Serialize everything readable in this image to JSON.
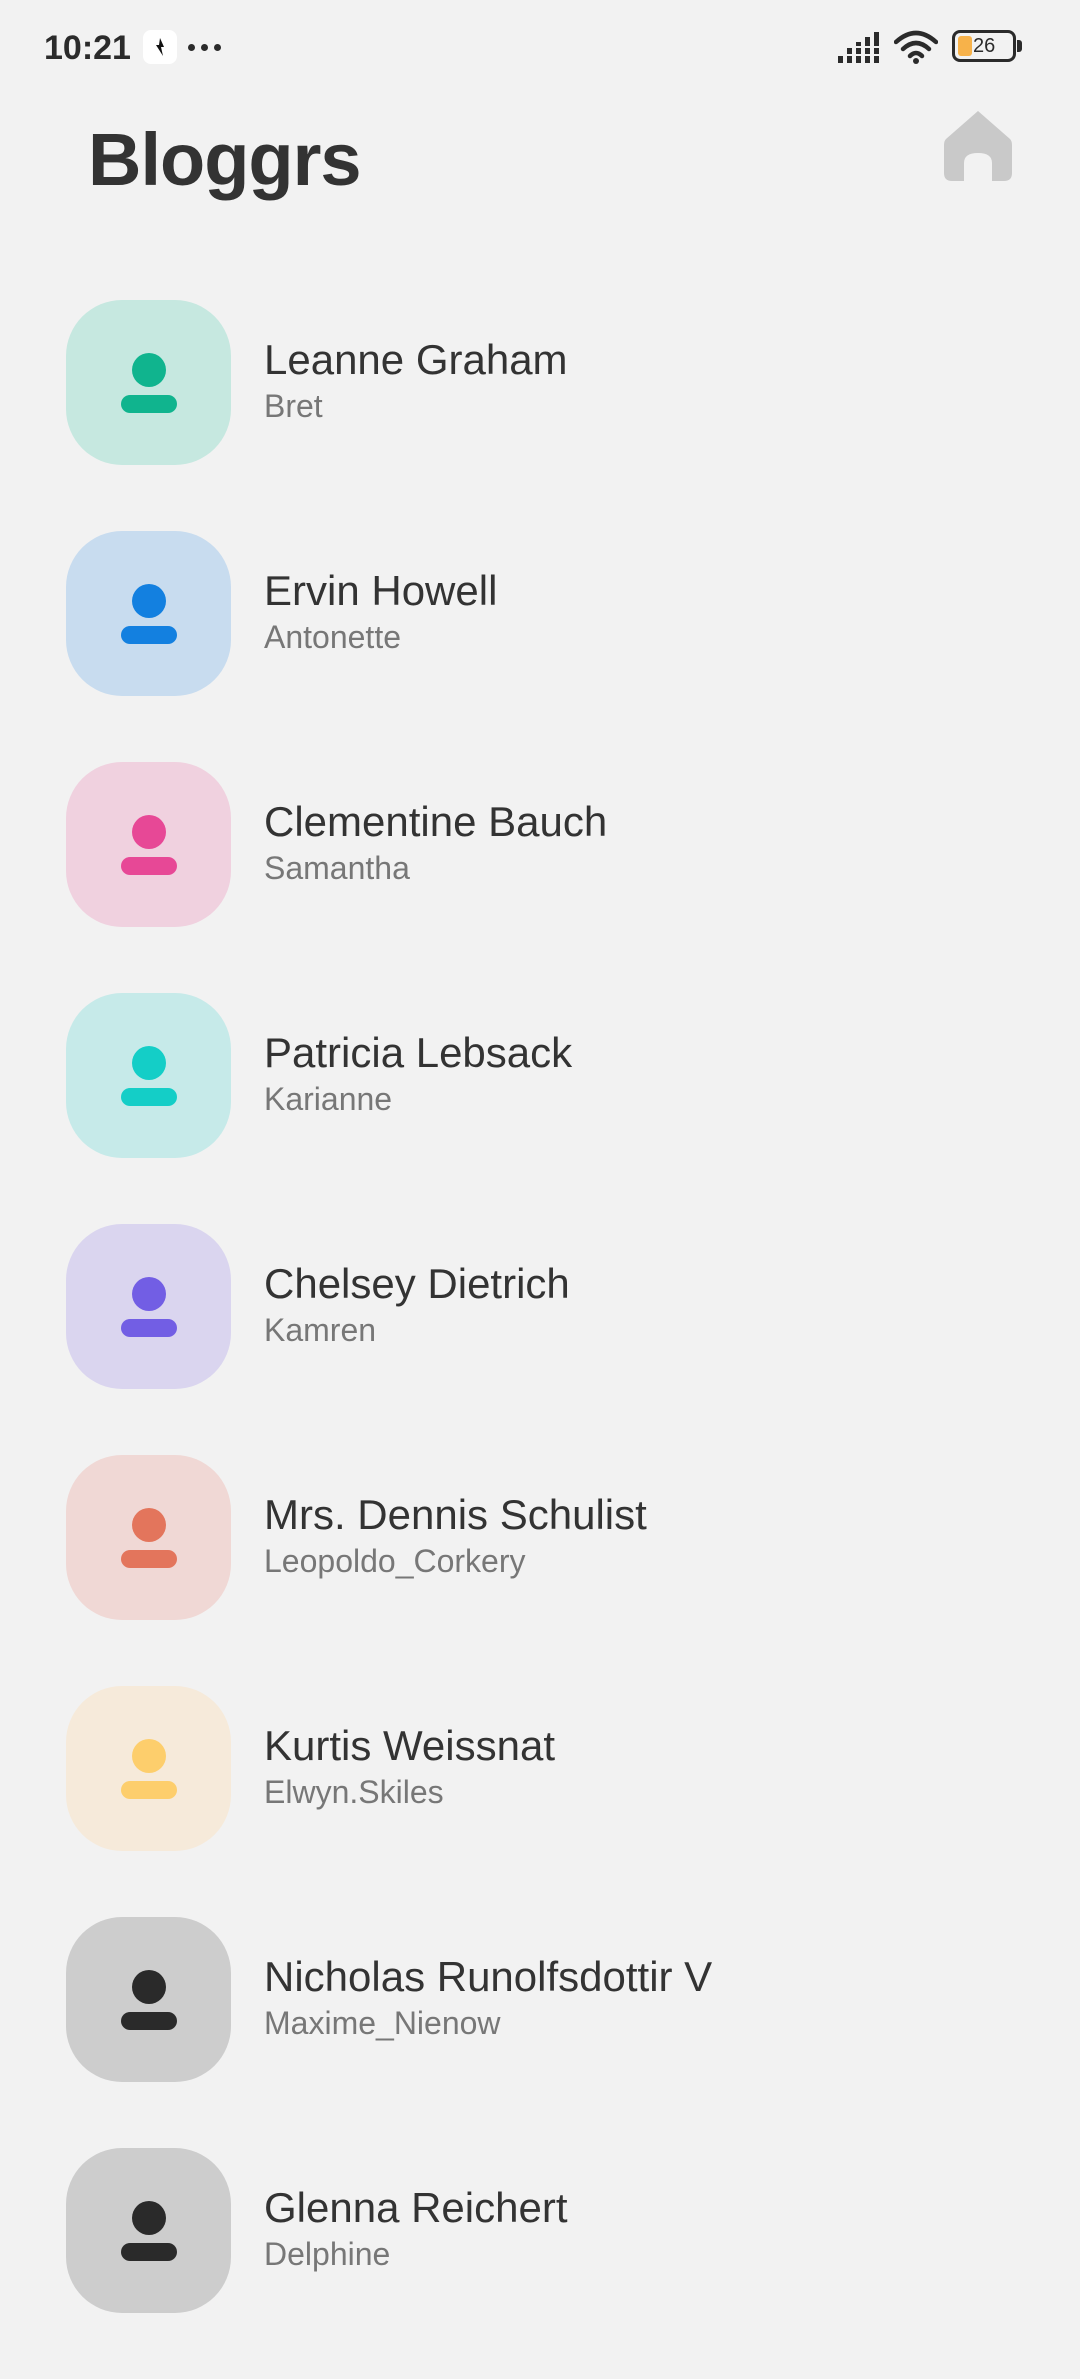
{
  "status_bar": {
    "time": "10:21",
    "battery_level": "26",
    "icons": [
      "app-notification-icon",
      "more-dots-icon",
      "signal-icon",
      "wifi-icon",
      "battery-icon"
    ]
  },
  "header": {
    "title": "Bloggrs",
    "home_icon": "home-icon"
  },
  "colors": {
    "background": "#f2f2f2",
    "title_text": "#333333",
    "secondary_text": "#777777",
    "home_icon": "#c9c9c9"
  },
  "users": [
    {
      "name": "Leanne Graham",
      "username": "Bret",
      "avatar_bg": "#c6e8e0",
      "icon_color": "#10b48e",
      "icon": "person-icon"
    },
    {
      "name": "Ervin Howell",
      "username": "Antonette",
      "avatar_bg": "#c8dcef",
      "icon_color": "#1380e0",
      "icon": "person-icon"
    },
    {
      "name": "Clementine Bauch",
      "username": "Samantha",
      "avatar_bg": "#f0d1df",
      "icon_color": "#e74896",
      "icon": "person-icon"
    },
    {
      "name": "Patricia Lebsack",
      "username": "Karianne",
      "avatar_bg": "#c6eae9",
      "icon_color": "#14cec7",
      "icon": "person-icon"
    },
    {
      "name": "Chelsey Dietrich",
      "username": "Kamren",
      "avatar_bg": "#dad5ef",
      "icon_color": "#725ee4",
      "icon": "person-icon"
    },
    {
      "name": "Mrs. Dennis Schulist",
      "username": "Leopoldo_Corkery",
      "avatar_bg": "#f0d8d5",
      "icon_color": "#e3755c",
      "icon": "person-icon"
    },
    {
      "name": "Kurtis Weissnat",
      "username": "Elwyn.Skiles",
      "avatar_bg": "#f6eada",
      "icon_color": "#fdce6c",
      "icon": "person-icon"
    },
    {
      "name": "Nicholas Runolfsdottir V",
      "username": "Maxime_Nienow",
      "avatar_bg": "#cdcdcd",
      "icon_color": "#2a2a2a",
      "icon": "person-icon"
    },
    {
      "name": "Glenna Reichert",
      "username": "Delphine",
      "avatar_bg": "#cdcdcd",
      "icon_color": "#2a2a2a",
      "icon": "person-icon"
    }
  ]
}
